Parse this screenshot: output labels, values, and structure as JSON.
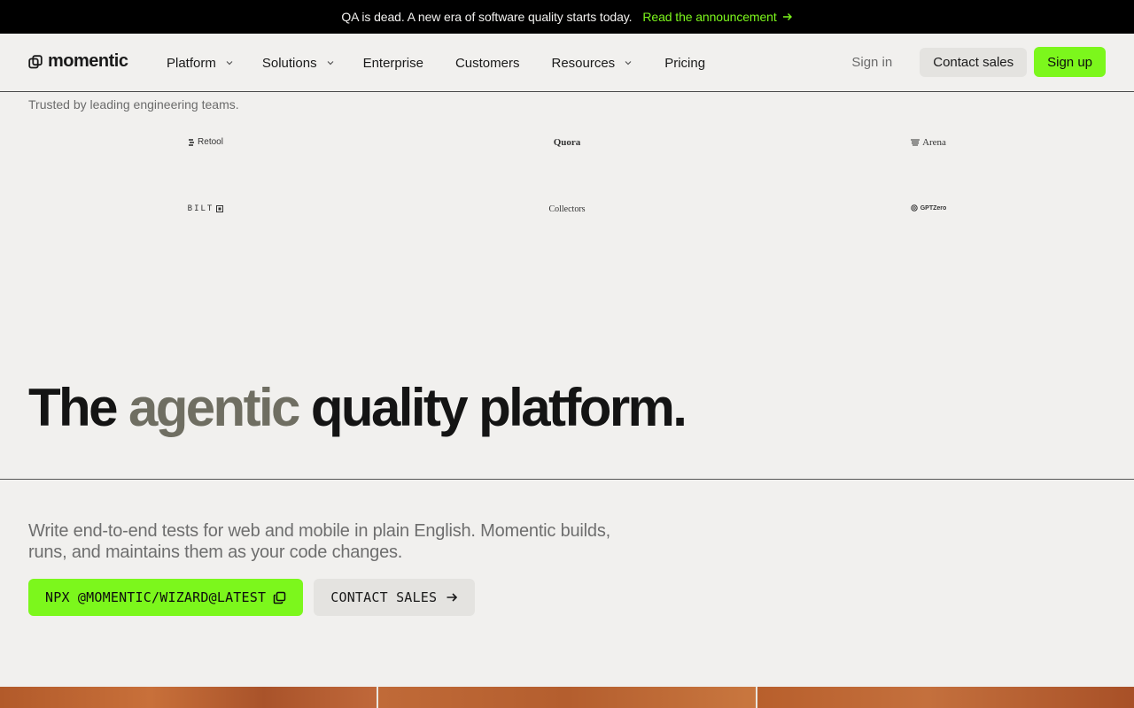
{
  "announcement": {
    "message": "QA is dead. A new era of software quality starts today.",
    "link_label": "Read the announcement"
  },
  "brand": {
    "name": "momentic"
  },
  "nav": {
    "items": [
      {
        "label": "Platform",
        "has_dropdown": true
      },
      {
        "label": "Solutions",
        "has_dropdown": true
      },
      {
        "label": "Enterprise",
        "has_dropdown": false
      },
      {
        "label": "Customers",
        "has_dropdown": false
      },
      {
        "label": "Resources",
        "has_dropdown": true
      },
      {
        "label": "Pricing",
        "has_dropdown": false
      }
    ],
    "sign_in": "Sign in",
    "contact_sales": "Contact sales",
    "sign_up": "Sign up"
  },
  "trusted": {
    "heading": "Trusted by leading engineering teams.",
    "logos": [
      "Retool",
      "Quora",
      "Arena",
      "BILT",
      "Collectors",
      "GPTZero"
    ]
  },
  "hero": {
    "title_before": "The ",
    "title_accent": "agentic",
    "title_after": " quality platform.",
    "subtitle": "Write end-to-end tests for web and mobile in plain English. Momentic builds, runs, and maintains them as your code changes.",
    "cta_primary": "NPX @MOMENTIC/WIZARD@LATEST",
    "cta_secondary": "CONTACT SALES"
  },
  "colors": {
    "accent_green": "#7cf71c",
    "background": "#f1f0ee",
    "title_accent": "#6f6e62",
    "announcement_bg": "#000000"
  },
  "icons": {
    "announcement_link": "arrow-right-icon",
    "dropdown": "chevron-down-icon",
    "cta_primary": "copy-icon",
    "cta_secondary": "arrow-right-icon"
  }
}
